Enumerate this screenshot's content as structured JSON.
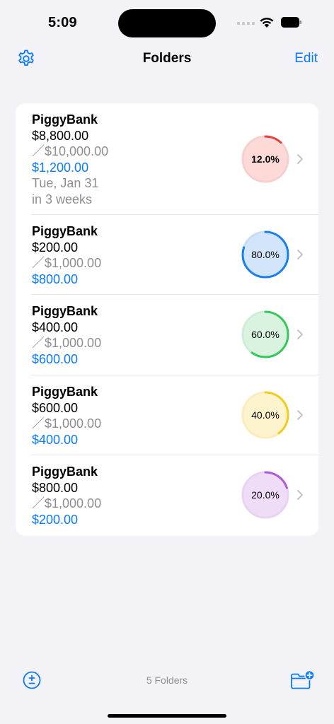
{
  "status": {
    "time": "5:09"
  },
  "nav": {
    "title": "Folders",
    "edit_label": "Edit"
  },
  "folders": [
    {
      "name": "PiggyBank",
      "balance": "$8,800.00",
      "goal": "／$10,000.00",
      "remaining": "$1,200.00",
      "date": "Tue, Jan 31",
      "relative": "in 3 weeks",
      "percent_label": "12.0%",
      "progress": 0.12,
      "color": "#e5423c",
      "fill": "#fdd9d8",
      "track": "#f6d0cf"
    },
    {
      "name": "PiggyBank",
      "balance": "$200.00",
      "goal": "／$1,000.00",
      "remaining": "$800.00",
      "percent_label": "80.0%",
      "progress": 0.8,
      "color": "#1a7ef0",
      "fill": "#d3e5fb",
      "track": "#c8dcf6"
    },
    {
      "name": "PiggyBank",
      "balance": "$400.00",
      "goal": "／$1,000.00",
      "remaining": "$600.00",
      "percent_label": "60.0%",
      "progress": 0.6,
      "color": "#35c759",
      "fill": "#d9f3df",
      "track": "#cdeed5"
    },
    {
      "name": "PiggyBank",
      "balance": "$600.00",
      "goal": "／$1,000.00",
      "remaining": "$400.00",
      "percent_label": "40.0%",
      "progress": 0.4,
      "color": "#f2cc1c",
      "fill": "#fdf3cc",
      "track": "#faecc0"
    },
    {
      "name": "PiggyBank",
      "balance": "$800.00",
      "goal": "／$1,000.00",
      "remaining": "$200.00",
      "percent_label": "20.0%",
      "progress": 0.2,
      "color": "#b05cd9",
      "fill": "#efdcf7",
      "track": "#e9d3f3"
    }
  ],
  "toolbar": {
    "count_label": "5 Folders",
    "left_icon": "plus-minus-circle-icon",
    "right_icon": "folder-badge-plus-icon"
  },
  "accent": "#0a7aff"
}
